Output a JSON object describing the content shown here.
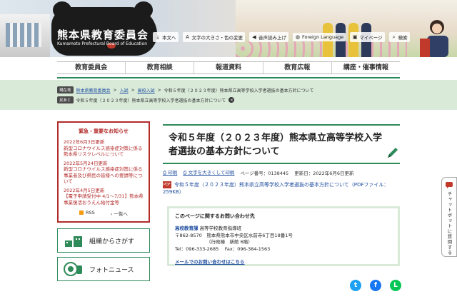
{
  "header": {
    "site_title": "熊本県教育委員会",
    "site_subtitle": "Kumamoto Prefectural Board of Education",
    "toolbar": [
      {
        "label": "本文へ",
        "icon": "arrow-down-icon"
      },
      {
        "label": "文字の大きさ・色の変更",
        "icon": "font-size-icon"
      },
      {
        "label": "音声読み上げ",
        "icon": "speaker-icon"
      },
      {
        "label": "Foreign Language",
        "icon": "globe-icon"
      },
      {
        "label": "マイページ",
        "icon": "mypage-icon"
      },
      {
        "label": "検索",
        "icon": "search-icon"
      }
    ]
  },
  "nav": {
    "items": [
      "教育委員会",
      "教育相談",
      "報道資料",
      "教育広報",
      "講座・催事情報"
    ]
  },
  "breadcrumb": {
    "current_label": "現在地",
    "links": [
      "熊本県教育委員会",
      "入試",
      "高校入試"
    ],
    "current_page": "令和５年度（２０２３年度）熊本県立高等学校入学者選抜の基本方針について",
    "history_label": "足あと",
    "history_item": "令和５年度（２０２３年度）熊本県立高等学校入学者選抜の基本方針について"
  },
  "news": {
    "title": "緊急・重要なお知らせ",
    "entries": [
      {
        "date": "2022年6月3日更新",
        "text": "新型コロナウイルス感染症対策に係る熊本県リスクレベルについて"
      },
      {
        "date": "2022年5月24日更新",
        "text": "新型コロナウイルス感染症対策に係る事業者及び県民の皆様への要請等について"
      },
      {
        "date": "2022年4月5日更新",
        "text": "【電子申請受付中 4/1～7/31】熊本県事業復活おうえん給付金等"
      }
    ],
    "rss_label": "RSS",
    "list_label": "一覧へ"
  },
  "sidebar": {
    "org_search": "組織からさがす",
    "photo_news": "フォトニュース"
  },
  "main": {
    "title": "令和５年度（２０２３年度）熊本県立高等学校入学者選抜の基本方針について",
    "print_label": "印刷",
    "large_print_label": "文字を大きくして印刷",
    "page_number": "ページ番号：0138445",
    "updated": "更新日：2022年6月6日更新",
    "pdf_link": "令和５年度（２０２３年度）熊本県立高等学校入学者選抜の基本方針について",
    "pdf_size": "（PDFファイル：259KB）"
  },
  "contact": {
    "heading": "このページに関するお問い合わせ先",
    "dept": "高校教育課",
    "section": "高等学校教育指導班",
    "address": "〒862-8570　熊本県熊本市中央区水前寺6丁目18番1号",
    "building": "（行政棟　新館 6階）",
    "phone": "Tel：096-333-2685　 Fax：096-384-1563",
    "mail_link": "メールでのお問い合わせはこちら"
  },
  "chatbot": {
    "label": "チャットボットに質問する"
  },
  "colors": {
    "accent_green": "#2f8a5a",
    "alert_red": "#b32a2a",
    "link_blue": "#1f4ea0"
  }
}
